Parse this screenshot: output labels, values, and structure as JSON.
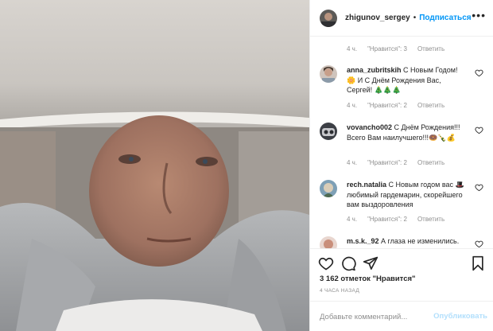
{
  "header": {
    "username": "zhigunov_sergey",
    "separator": "•",
    "follow_label": "Подписаться",
    "more_label": "•••"
  },
  "first_meta": {
    "time": "4 ч.",
    "likes": "\"Нравится\": 3",
    "reply": "Ответить"
  },
  "comments": [
    {
      "username": "anna_zubritskih",
      "text": "С Новым Годом! 🌼 И С Днём Рождения Вас, Сергей! 🎄🎄🎄",
      "time": "4 ч.",
      "likes": "\"Нравится\": 2",
      "reply": "Ответить"
    },
    {
      "username": "vovancho002",
      "text": "С Днём Рождения!!! Всего Вам наилучшего!!!🍩🍾💰",
      "time": "4 ч.",
      "likes": "\"Нравится\": 2",
      "reply": "Ответить"
    },
    {
      "username": "rech.natalia",
      "text": "С Новым годом вас 🎩любимый гардемарин, скорейшего вам выздоровления",
      "time": "4 ч.",
      "likes": "\"Нравится\": 2",
      "reply": "Ответить"
    },
    {
      "username": "m.s.k._92",
      "text": "А глаза не изменились."
    }
  ],
  "likes_summary": "3 162 отметок \"Нравится\"",
  "timestamp": "4 часа назад",
  "add_comment": {
    "placeholder": "Добавьте комментарий...",
    "publish_label": "Опубликовать"
  },
  "colors": {
    "accent": "#0095f6",
    "publish_disabled": "#b2dffc",
    "muted": "#8e8e8e",
    "text": "#262626"
  }
}
